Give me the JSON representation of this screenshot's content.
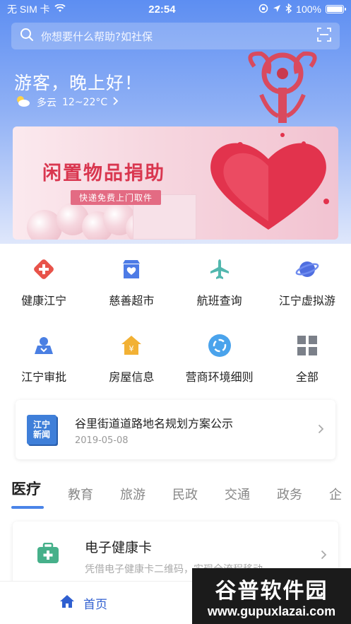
{
  "status_bar": {
    "carrier": "无 SIM 卡",
    "time": "22:54",
    "battery": "100%",
    "icons": [
      "wifi-icon",
      "rotation-lock-icon",
      "location-arrow-icon",
      "bluetooth-icon",
      "battery-icon"
    ]
  },
  "search": {
    "placeholder": "你想要什么帮助?如社保",
    "icons": [
      "search-icon",
      "scan-icon"
    ]
  },
  "greeting": "游客，晚上好！",
  "weather": {
    "condition": "多云",
    "temperature": "12~22°C",
    "icon": "partly-cloudy-icon"
  },
  "banner": {
    "title": "闲置物品捐助",
    "subtitle": "快递免费上门取件"
  },
  "services": [
    {
      "label": "健康江宁",
      "icon": "health-cross-icon",
      "color": "#e8534a"
    },
    {
      "label": "慈善超市",
      "icon": "charity-store-icon",
      "color": "#4d7be6"
    },
    {
      "label": "航班查询",
      "icon": "airplane-icon",
      "color": "#52b7ae"
    },
    {
      "label": "江宁虚拟游",
      "icon": "planet-icon",
      "color": "#4f6ee0"
    },
    {
      "label": "江宁审批",
      "icon": "approval-user-icon",
      "color": "#4a7fe3"
    },
    {
      "label": "房屋信息",
      "icon": "house-yuan-icon",
      "color": "#f2b134"
    },
    {
      "label": "营商环境细则",
      "icon": "business-circle-icon",
      "color": "#4aa3ec"
    },
    {
      "label": "全部",
      "icon": "grid-all-icon",
      "color": "#7b8089"
    }
  ],
  "news": {
    "logo_line1": "江宁",
    "logo_line2": "新闻",
    "title": "谷里街道道路地名规划方案公示",
    "date": "2019-05-08"
  },
  "tabs": [
    "医疗",
    "教育",
    "旅游",
    "民政",
    "交通",
    "政务",
    "企"
  ],
  "active_tab": "医疗",
  "service_card": {
    "title": "电子健康卡",
    "description": "凭借电子健康卡二维码，实现全流程移动…"
  },
  "bottom_nav": {
    "home_label": "首页"
  },
  "watermark": {
    "title": "谷普软件园",
    "url": "www.gupuxlazai.com"
  },
  "colors": {
    "accent": "#4a84e8",
    "hero_top": "#5d8ef2",
    "banner_title": "#d9364f"
  }
}
